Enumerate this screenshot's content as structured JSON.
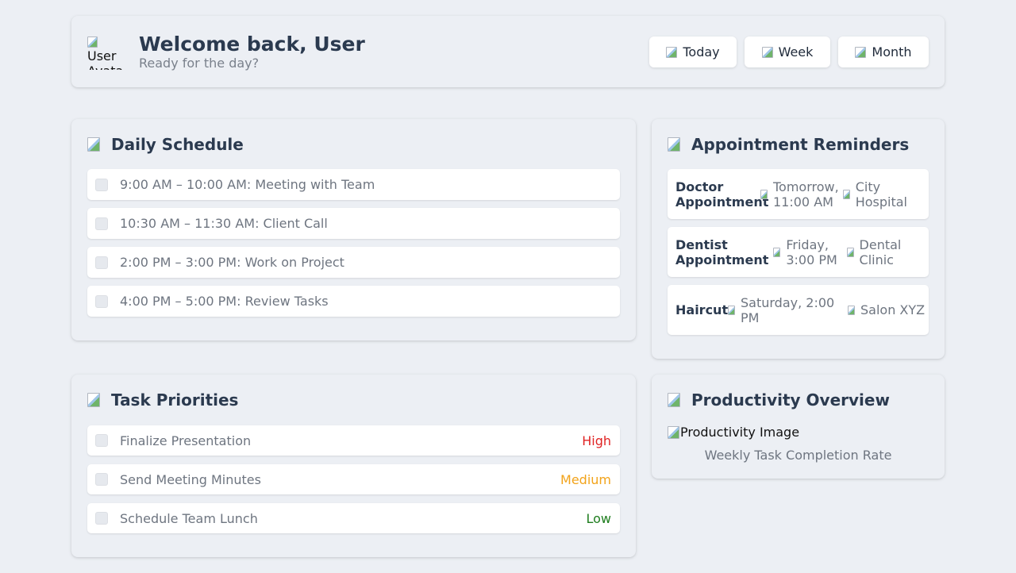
{
  "header": {
    "avatar_alt": "User Avatar",
    "welcome": "Welcome back, User",
    "subtitle": "Ready for the day?",
    "buttons": [
      {
        "label": "Today",
        "icon": "calendar-day-icon"
      },
      {
        "label": "Week",
        "icon": "calendar-week-icon"
      },
      {
        "label": "Month",
        "icon": "calendar-month-icon"
      }
    ]
  },
  "schedule": {
    "title": "Daily Schedule",
    "icon": "schedule-icon",
    "items": [
      {
        "text": "9:00 AM – 10:00 AM: Meeting with Team",
        "checked": false
      },
      {
        "text": "10:30 AM – 11:30 AM: Client Call",
        "checked": false
      },
      {
        "text": "2:00 PM – 3:00 PM: Work on Project",
        "checked": false
      },
      {
        "text": "4:00 PM – 5:00 PM: Review Tasks",
        "checked": false
      }
    ]
  },
  "tasks": {
    "title": "Task Priorities",
    "icon": "priority-icon",
    "items": [
      {
        "text": "Finalize Presentation",
        "priority": "High",
        "color": "#e02424"
      },
      {
        "text": "Send Meeting Minutes",
        "priority": "Medium",
        "color": "#f2a31a"
      },
      {
        "text": "Schedule Team Lunch",
        "priority": "Low",
        "color": "#1e7d1e"
      }
    ]
  },
  "appointments": {
    "title": "Appointment Reminders",
    "icon": "reminder-icon",
    "items": [
      {
        "name": "Doctor Appointment",
        "when": "Tomorrow, 11:00 AM",
        "where": "City Hospital"
      },
      {
        "name": "Dentist Appointment",
        "when": "Friday, 3:00 PM",
        "where": "Dental Clinic"
      },
      {
        "name": "Haircut",
        "when": "Saturday, 2:00 PM",
        "where": "Salon XYZ"
      }
    ]
  },
  "productivity": {
    "title": "Productivity Overview",
    "icon": "chart-icon",
    "image_alt": "Productivity Image",
    "caption": "Weekly Task Completion Rate"
  }
}
